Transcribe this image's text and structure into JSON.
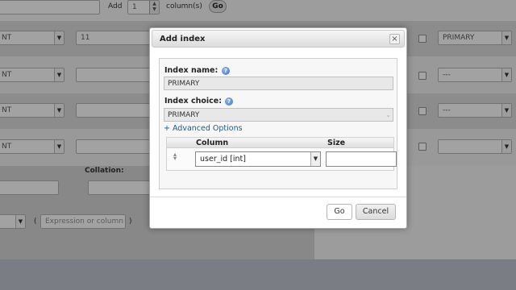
{
  "toolbar": {
    "add_label": "Add",
    "add_count": "1",
    "columns_label": "column(s)",
    "go_label": "Go"
  },
  "rows": [
    {
      "type": "NT",
      "length": "11",
      "index": "PRIMARY"
    },
    {
      "type": "NT",
      "length": "",
      "index": "---"
    },
    {
      "type": "NT",
      "length": "",
      "index": "---"
    },
    {
      "type": "NT",
      "length": "",
      "index": ""
    }
  ],
  "table_options": {
    "collation_label": "Collation:",
    "expression_open": "(",
    "expression_placeholder": "Expression or column list",
    "expression_close": ")"
  },
  "dialog": {
    "title": "Add index",
    "close_glyph": "×",
    "index_name_label": "Index name:",
    "index_name_value": "PRIMARY",
    "index_choice_label": "Index choice:",
    "index_choice_value": "PRIMARY",
    "advanced_options": "+ Advanced Options",
    "column_header": "Column",
    "size_header": "Size",
    "column_value": "user_id [int]",
    "size_value": "",
    "go_button": "Go",
    "cancel_button": "Cancel"
  },
  "icons": {
    "help": "help-icon",
    "dropdown": "chevron-down-icon",
    "drag": "drag-handle-icon",
    "close": "close-icon"
  },
  "colors": {
    "link": "#235a81",
    "help_icon": "#3c75c4",
    "overlay": "rgba(0,0,0,0.32)"
  }
}
